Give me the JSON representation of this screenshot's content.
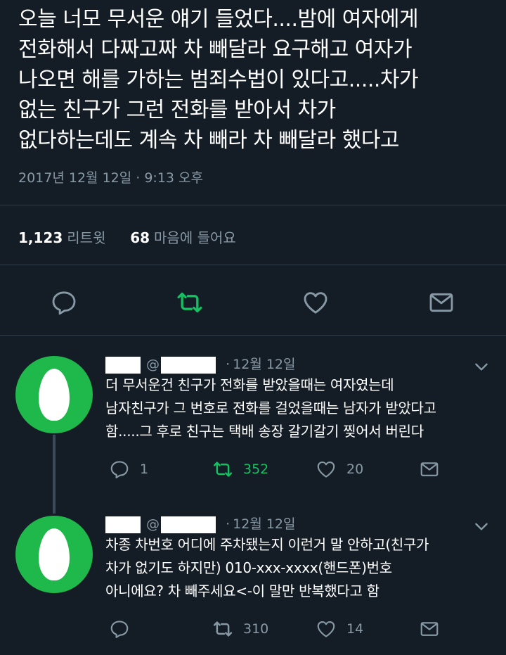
{
  "tweet": {
    "lines": [
      "오늘 너모 무서운 얘기 들었다....밤에 여자에게",
      "전화해서 다짜고짜 차 빼달라 요구해고 여자가",
      "나오면 해를 가하는 범죄수법이 있다고.....차가",
      "없는 친구가 그런 전화를 받아서 차가",
      "없다하는데도 계속 차 빼라 차 빼달라 했다고"
    ],
    "timestamp": "2017년 12월 12일 · 9:13 오후",
    "retweet_count": "1,123",
    "retweet_label": "리트윗",
    "like_count": "68",
    "like_label": "마음에 들어요"
  },
  "replies": [
    {
      "at": "@",
      "date": "12월 12일",
      "lines": [
        "더 무서운건 친구가 전화를 받았을때는 여자였는데",
        "남자친구가 그 번호로 전화를 걸었을때는 남자가 받았다고",
        "함.....그 후로 친구는 택배 송장 갈기갈기 찢어서 버린다"
      ],
      "reply_count": "1",
      "retweet_count": "352",
      "like_count": "20"
    },
    {
      "at": "@",
      "date": "12월 12일",
      "lines": [
        "차종 차번호 어디에 주차됐는지 이런거 말 안하고(친구가",
        "차가 없기도 하지만) 010-xxx-xxxx(핸드폰)번호",
        "아니에요? 차 빼주세요<-이 말만 반복했다고 함"
      ],
      "reply_count": "",
      "retweet_count": "310",
      "like_count": "14"
    }
  ],
  "icons": {
    "reply": "reply-icon",
    "retweet": "retweet-icon",
    "like": "heart-icon",
    "dm": "envelope-icon",
    "more": "chevron-down-icon"
  },
  "colors": {
    "background": "#141d26",
    "muted": "#8899a6",
    "retweet_active": "#17bf63",
    "avatar": "#1fb84a"
  }
}
